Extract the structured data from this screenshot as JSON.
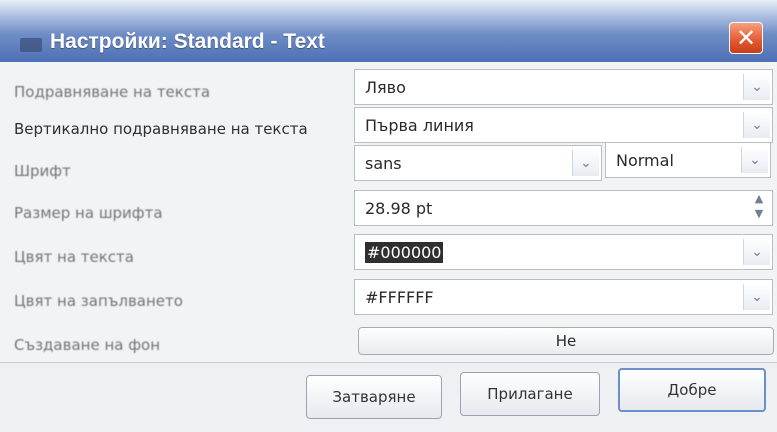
{
  "window": {
    "title": "Настройки: Standard - Text",
    "close_glyph": "✕"
  },
  "rows": [
    {
      "label": "Подравняване на текста",
      "value": "Ляво"
    },
    {
      "label": "Вертикално подравняване на текста",
      "value": "Първа линия"
    },
    {
      "label": "Шрифт",
      "value": "sans",
      "value2": "Normal"
    },
    {
      "label": "Размер на шрифта",
      "value": "28.98 pt"
    },
    {
      "label": "Цвят на текста",
      "value": "#000000"
    },
    {
      "label": "Цвят на запълването",
      "value": "#FFFFFF"
    },
    {
      "label": "Създаване на фон",
      "value": "Не"
    }
  ],
  "icons": {
    "dropdown": "chevron-down-icon",
    "spin": "spin-arrows-icon",
    "close": "close-icon"
  },
  "buttons": {
    "close": "Затваряне",
    "apply": "Прилагане",
    "ok": "Добре"
  },
  "colors": {
    "title_bar": "#4d70b4",
    "close_button": "#e2582f",
    "text_color_value": "#000000",
    "fill_color_value": "#FFFFFF"
  }
}
